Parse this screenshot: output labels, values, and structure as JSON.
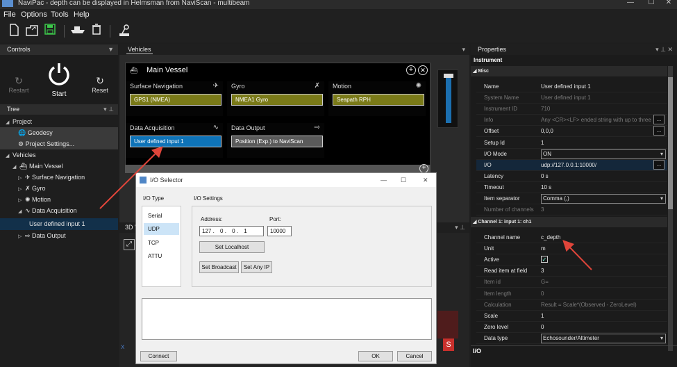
{
  "window": {
    "title": "NaviPac - depth can be displayed in Helmsman from NaviScan - multibeam",
    "controls": [
      "—",
      "☐",
      "✕"
    ]
  },
  "menu": [
    "File",
    "Options",
    "Tools",
    "Help"
  ],
  "toolbar": {
    "icons": [
      "new-file-icon",
      "open-file-icon",
      "save-icon",
      "vessel-icon",
      "delete-icon",
      "joystick-icon"
    ]
  },
  "controls_panel": {
    "title": "Controls",
    "restart": "Restart",
    "start": "Start",
    "reset": "Reset"
  },
  "tree": {
    "title": "Tree",
    "items": [
      {
        "label": "Project"
      },
      {
        "label": "Geodesy"
      },
      {
        "label": "Project Settings..."
      },
      {
        "label": "Vehicles"
      },
      {
        "label": "Main Vessel"
      },
      {
        "label": "Surface Navigation"
      },
      {
        "label": "Gyro"
      },
      {
        "label": "Motion"
      },
      {
        "label": "Data Acquisition"
      },
      {
        "label": "User defined input 1"
      },
      {
        "label": "Data Output"
      }
    ]
  },
  "vehicles_panel": {
    "tab": "Vehicles",
    "vessel_name": "Main Vessel",
    "sensors": [
      {
        "title": "Surface Navigation",
        "button": "GPS1 (NMEA)"
      },
      {
        "title": "Gyro",
        "button": "NMEA1 Gyro"
      },
      {
        "title": "Motion",
        "button": "Seapath RPH"
      },
      {
        "title": "Data Acquisition",
        "button": "User defined input 1"
      },
      {
        "title": "Data Output",
        "button": "Position (Exp.) to NaviScan"
      }
    ],
    "view3d_tab": "3D V",
    "axis_label": "X",
    "badge": "S"
  },
  "io_selector": {
    "title": "I/O Selector",
    "io_type_label": "I/O Type",
    "io_types": [
      "Serial",
      "UDP",
      "TCP",
      "ATTU"
    ],
    "selected_type": "UDP",
    "io_settings_label": "I/O Settings",
    "address_label": "Address:",
    "address_octets": [
      "127",
      "0",
      "0",
      "1"
    ],
    "port_label": "Port:",
    "port_value": "10000",
    "set_localhost": "Set Localhost",
    "set_broadcast": "Set Broadcast",
    "set_any_ip": "Set Any IP",
    "connect": "Connect",
    "ok": "OK",
    "cancel": "Cancel"
  },
  "properties": {
    "title": "Properties",
    "section": "Instrument",
    "misc_label": "Misc",
    "misc_rows": [
      {
        "name": "Name",
        "value": "User defined input 1",
        "dim": false
      },
      {
        "name": "System Name",
        "value": "User defined input 1",
        "dim": true
      },
      {
        "name": "Instrument ID",
        "value": "710",
        "dim": true
      },
      {
        "name": "Info",
        "value": "Any <CR><LF> ended string with up to three ite",
        "dim": true
      },
      {
        "name": "Offset",
        "value": "0,0,0",
        "dim": false
      },
      {
        "name": "Setup Id",
        "value": "1",
        "dim": false
      },
      {
        "name": "I/O Mode",
        "value": "ON",
        "dim": false
      },
      {
        "name": "I/O",
        "value": "udp://127.0.0.1:10000/",
        "dim": false
      },
      {
        "name": "Latency",
        "value": "0 s",
        "dim": false
      },
      {
        "name": "Timeout",
        "value": "10 s",
        "dim": false
      },
      {
        "name": "Item separator",
        "value": "Comma (,)",
        "dim": false
      },
      {
        "name": "Number of channels",
        "value": "3",
        "dim": true
      }
    ],
    "channel_label": "Channel 1: input 1: ch1",
    "channel_rows": [
      {
        "name": "Channel name",
        "value": "c_depth",
        "dim": false
      },
      {
        "name": "Unit",
        "value": "m",
        "dim": false
      },
      {
        "name": "Active",
        "value": "✓",
        "dim": false
      },
      {
        "name": "Read item at field",
        "value": "3",
        "dim": false
      },
      {
        "name": "Item id",
        "value": "G=",
        "dim": true
      },
      {
        "name": "Item length",
        "value": "0",
        "dim": true
      },
      {
        "name": "Calculation",
        "value": "Result = Scale*(Observed - ZeroLevel)",
        "dim": true
      },
      {
        "name": "Scale",
        "value": "1",
        "dim": false
      },
      {
        "name": "Zero level",
        "value": "0",
        "dim": false
      },
      {
        "name": "Data type",
        "value": "Echosounder/Altimeter",
        "dim": false
      }
    ],
    "footer": "I/O"
  },
  "colors": {
    "accent_blue": "#0e73b8",
    "olive": "#7a7a18",
    "annotation_red": "#e0453a"
  }
}
